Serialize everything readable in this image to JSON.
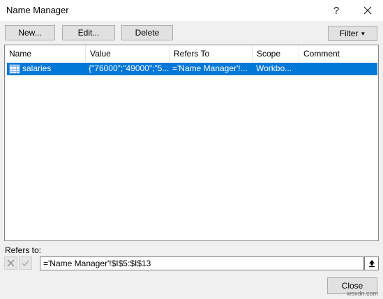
{
  "window": {
    "title": "Name Manager",
    "help_label": "?"
  },
  "toolbar": {
    "new_label": "New...",
    "edit_label": "Edit...",
    "delete_label": "Delete",
    "filter_label": "Filter"
  },
  "table": {
    "columns": [
      "Name",
      "Value",
      "Refers To",
      "Scope",
      "Comment"
    ],
    "rows": [
      {
        "icon": "named-range-icon",
        "name": "salaries",
        "value": "{\"76000\";\"49000\";\"5...",
        "refers_to": "='Name Manager'!...",
        "scope": "Workbo...",
        "comment": "",
        "selected": true
      }
    ]
  },
  "refers_to": {
    "label": "Refers to:",
    "value": "='Name Manager'!$I$5:$I$13"
  },
  "footer": {
    "close_label": "Close",
    "watermark": "wsxdn.com"
  },
  "colors": {
    "selection": "#0078d7",
    "background": "#f0f0f0"
  }
}
